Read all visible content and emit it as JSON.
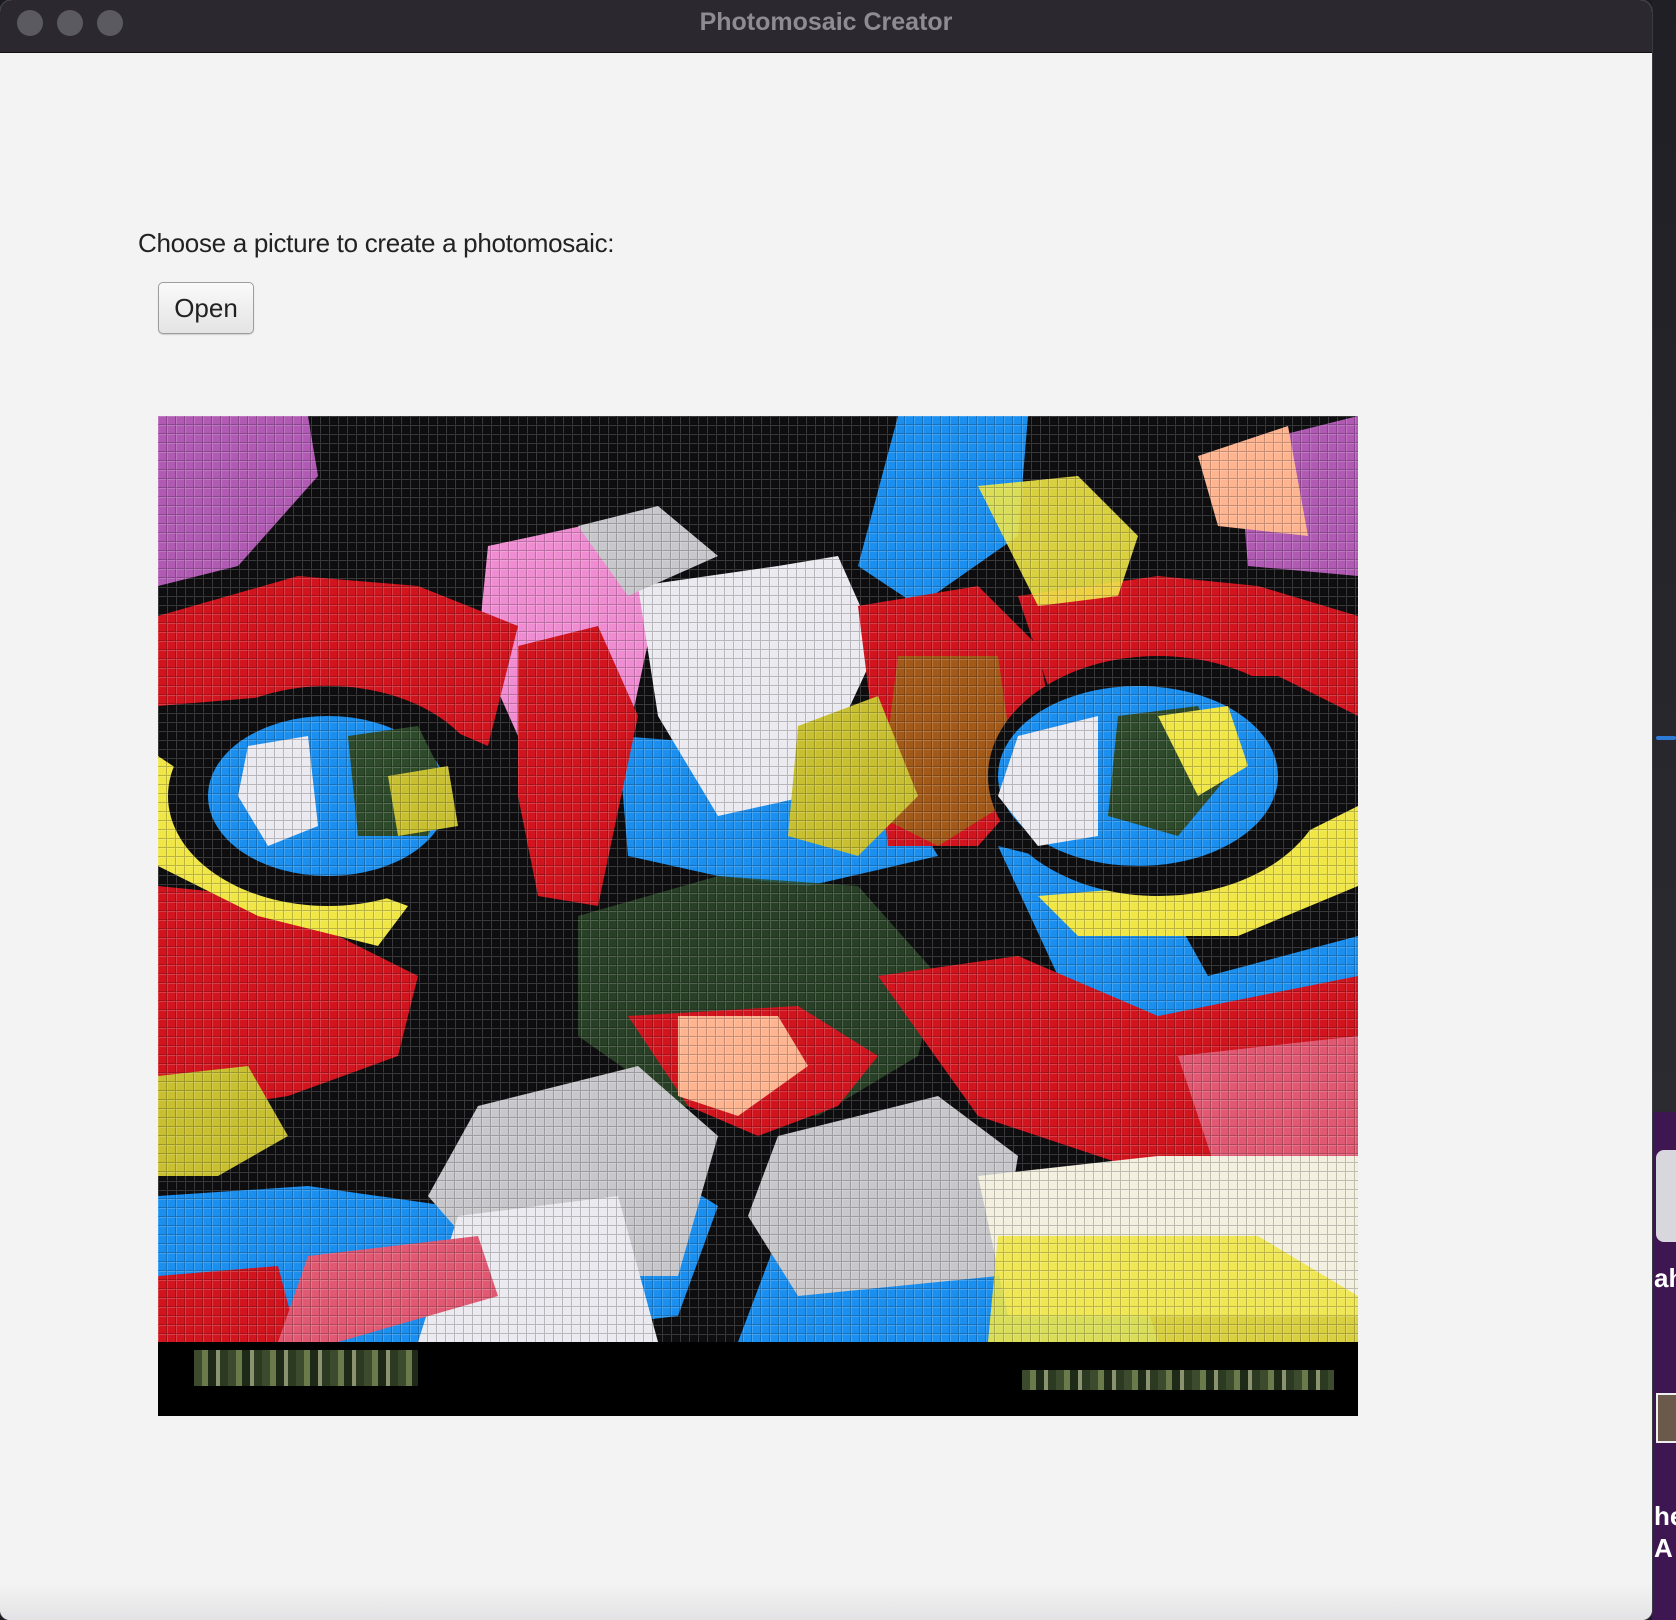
{
  "window": {
    "title": "Photomosaic Creator"
  },
  "main": {
    "prompt": "Choose a picture to create a photomosaic:",
    "open_button_label": "Open"
  },
  "mosaic": {
    "palette": [
      "#0e0e10",
      "#1a8ff0",
      "#d2141e",
      "#f0e646",
      "#eaeaf0",
      "#c8c8cc",
      "#f08cd2",
      "#2d4a2a",
      "#a35a18",
      "#ffb490",
      "#b05ab4"
    ]
  },
  "desktop": {
    "partial_texts": [
      "ah",
      "he",
      "A"
    ]
  }
}
